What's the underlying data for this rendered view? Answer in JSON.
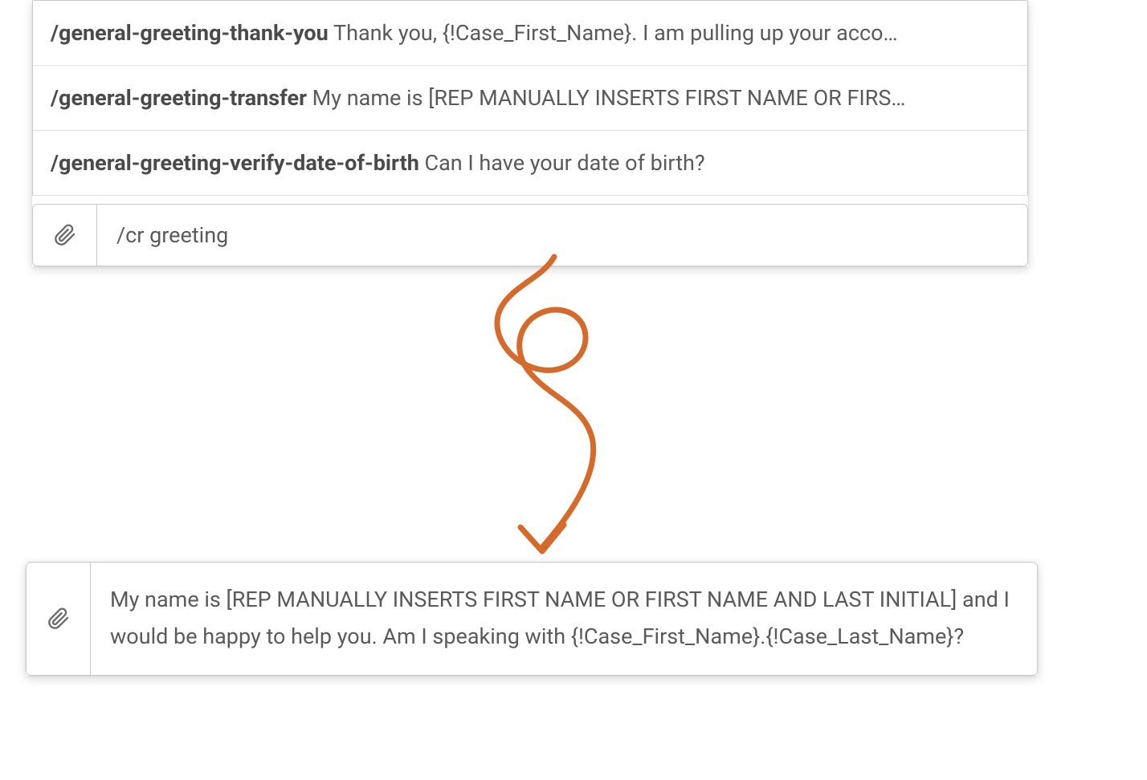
{
  "suggestions": {
    "items": [
      {
        "command": "/general-greeting-thank-you",
        "text": " Thank you, {!Case_First_Name}. I am pulling up your acco…"
      },
      {
        "command": "/general-greeting-transfer",
        "text": " My name is [REP MANUALLY INSERTS FIRST NAME OR FIRS…"
      },
      {
        "command": "/general-greeting-verify-date-of-birth",
        "text": " Can I have your date of birth?"
      }
    ]
  },
  "input_box_top": {
    "value": "/cr greeting"
  },
  "input_box_bottom": {
    "value": "My name is [REP MANUALLY INSERTS FIRST NAME OR FIRST NAME AND LAST INITIAL] and I would be happy to help you. Am I speaking with {!Case_First_Name}.{!Case_Last_Name}?"
  },
  "colors": {
    "arrow": "#d56a2b"
  }
}
